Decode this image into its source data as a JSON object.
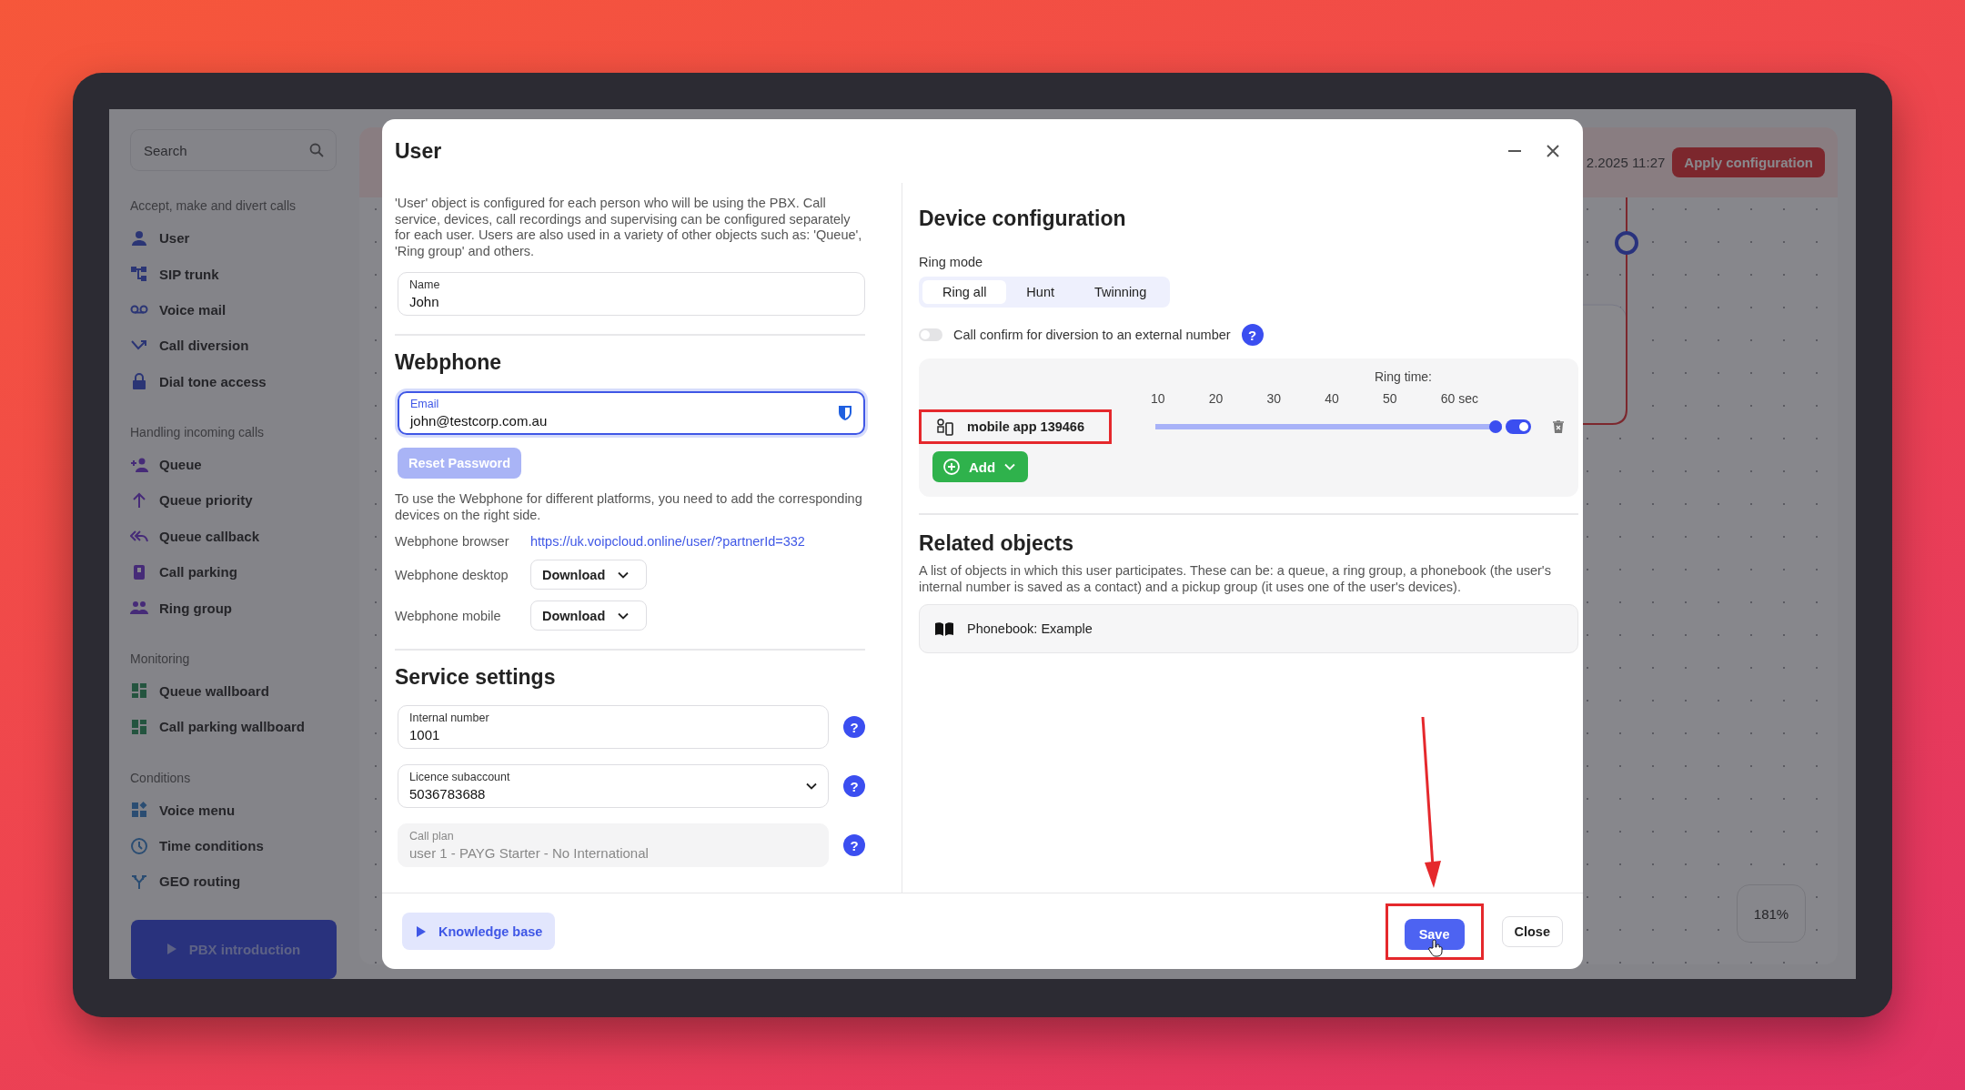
{
  "sidebar": {
    "search": {
      "placeholder": "Search"
    },
    "sections": [
      {
        "title": "Accept, make and divert calls",
        "items": [
          {
            "label": "User"
          },
          {
            "label": "SIP trunk"
          },
          {
            "label": "Voice mail"
          },
          {
            "label": "Call diversion"
          },
          {
            "label": "Dial tone access"
          }
        ]
      },
      {
        "title": "Handling incoming calls",
        "items": [
          {
            "label": "Queue"
          },
          {
            "label": "Queue priority"
          },
          {
            "label": "Queue callback"
          },
          {
            "label": "Call parking"
          },
          {
            "label": "Ring group"
          }
        ]
      },
      {
        "title": "Monitoring",
        "items": [
          {
            "label": "Queue wallboard"
          },
          {
            "label": "Call parking wallboard"
          }
        ]
      },
      {
        "title": "Conditions",
        "items": [
          {
            "label": "Voice menu"
          },
          {
            "label": "Time conditions"
          },
          {
            "label": "GEO routing"
          }
        ]
      }
    ],
    "intro_button": "PBX introduction"
  },
  "main": {
    "timestamp": "2.2025 11:27",
    "apply_button": "Apply configuration",
    "zoom": "181%"
  },
  "dialog": {
    "title": "User",
    "description": "'User' object is configured for each person who will be using the PBX. Call service, devices, call recordings and supervising can be configured separately for each user. Users are also used in a variety of other objects such as: 'Queue', 'Ring group' and others.",
    "name_field": {
      "label": "Name",
      "value": "John"
    },
    "webphone": {
      "heading": "Webphone",
      "email_field": {
        "label": "Email",
        "value": "john@testcorp.com.au",
        "focused": true
      },
      "reset_button": {
        "label": "Reset Password",
        "disabled": true
      },
      "note": "To use the Webphone for different platforms, you need to add the corresponding devices on the right side.",
      "browser": {
        "label": "Webphone browser",
        "link": "https://uk.voipcloud.online/user/?partnerId=332"
      },
      "downloads": [
        {
          "label": "Webphone desktop",
          "button": "Download"
        },
        {
          "label": "Webphone mobile",
          "button": "Download"
        }
      ]
    },
    "service": {
      "heading": "Service settings",
      "fields": [
        {
          "kind": "text",
          "label": "Internal number",
          "value": "1001",
          "disabled": false,
          "help": "?"
        },
        {
          "kind": "select",
          "label": "Licence subaccount",
          "value": "5036783688",
          "disabled": false,
          "help": "?"
        },
        {
          "kind": "text",
          "label": "Call plan",
          "value": "user 1 - PAYG Starter - No International",
          "disabled": true,
          "help": "?"
        }
      ]
    },
    "device_config": {
      "heading": "Device configuration",
      "ring_mode_label": "Ring mode",
      "ring_modes": [
        {
          "label": "Ring all",
          "selected": true
        },
        {
          "label": "Hunt",
          "selected": false
        },
        {
          "label": "Twinning",
          "selected": false
        }
      ],
      "call_confirm": {
        "label": "Call confirm for diversion to an external number",
        "on": false,
        "help": "?"
      },
      "ring_time_label": "Ring time:",
      "ticks": [
        "10",
        "20",
        "30",
        "40",
        "50",
        "60 sec"
      ],
      "devices": [
        {
          "name": "mobile app 139466",
          "level": 1,
          "on": true
        }
      ],
      "add_button": "Add"
    },
    "related": {
      "heading": "Related objects",
      "description": "A list of objects in which this user participates. These can be: a queue, a ring group, a phonebook (the user's internal number is saved as a contact) and a pickup group (it uses one of the user's devices).",
      "items": [
        {
          "label": "Phonebook: Example"
        }
      ]
    },
    "footer": {
      "knowledge_button": "Knowledge base",
      "save_button": "Save",
      "close_button": "Close"
    }
  }
}
